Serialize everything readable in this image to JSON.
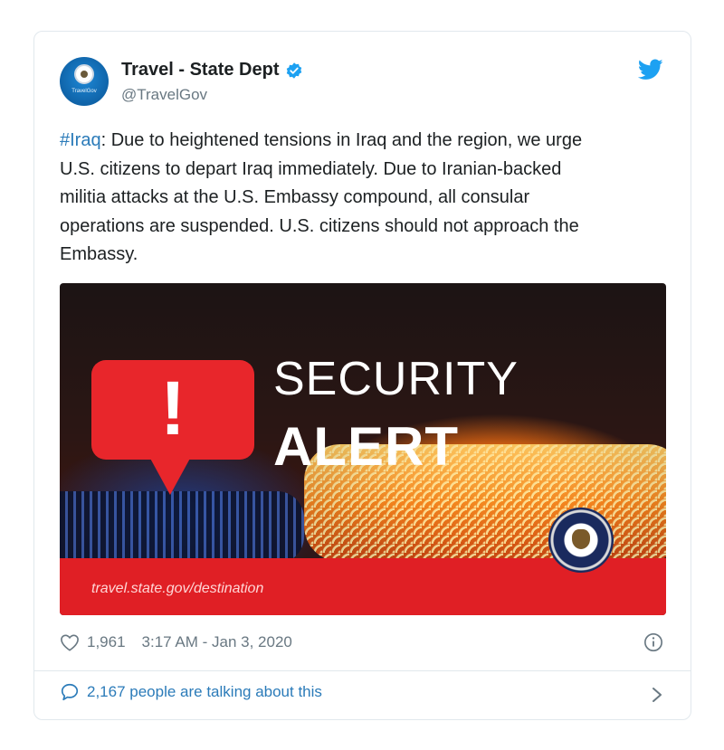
{
  "account": {
    "name": "Travel - State Dept",
    "handle": "@TravelGov",
    "avatar_text": "TravelGov",
    "verified": true
  },
  "tweet": {
    "hashtag": "#Iraq",
    "text": ": Due to heightened tensions in Iraq and the region, we urge\nU.S. citizens to depart Iraq immediately. Due to Iranian-backed\nmilitia attacks at the U.S. Embassy compound, all consular\noperations are suspended. U.S. citizens should not approach the\nEmbassy."
  },
  "media": {
    "title": "SECURITY",
    "subtitle": "ALERT",
    "url": "travel.state.gov/destination",
    "bang": "!"
  },
  "meta": {
    "likes": "1,961",
    "timestamp": "3:17 AM - Jan 3, 2020"
  },
  "conversation": {
    "label": "2,167 people are talking about this"
  },
  "icons": {
    "verified": "verified-badge-icon",
    "bird": "twitter-bird-icon",
    "heart": "heart-icon",
    "info": "info-icon",
    "reply": "speech-bubble-icon",
    "chevron": "chevron-right-icon"
  },
  "colors": {
    "link": "#2b7bb9",
    "muted": "#697882",
    "alert_red": "#e01f25",
    "twitter_blue": "#1da1f2"
  }
}
